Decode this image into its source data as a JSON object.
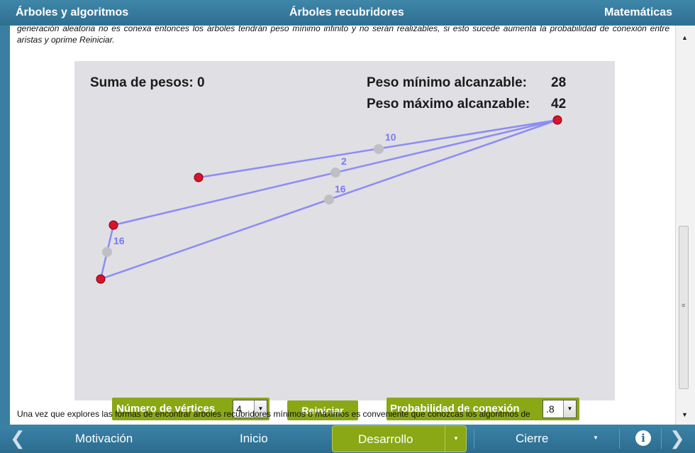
{
  "header": {
    "left_title": "Árboles y algoritmos",
    "center_title": "Árboles recubridores",
    "right_title": "Matemáticas"
  },
  "content": {
    "top_paragraph": "generación aleatoria no es conexa entonces los árboles tendrán peso mínimo infinito y no serán realizables, si esto sucede aumenta la probabilidad de conexión entre aristas y oprime Reiniciar.",
    "bottom_paragraph": "Una vez que explores las formas de encontrar árboles recubridores mínimos o máximos es conveniente que conozcas los algoritmos de"
  },
  "simulation": {
    "sum_label": "Suma de pesos: 0",
    "min_label": "Peso mínimo alcanzable:",
    "min_value": "28",
    "max_label": "Peso máximo alcanzable:",
    "max_value": "42",
    "edge_weights": [
      "10",
      "2",
      "16",
      "16"
    ],
    "colors": {
      "edge": "#8c8cf4",
      "vertex": "#d8142c",
      "midpoint": "#c0c0c4",
      "background": "#e0dfe3"
    }
  },
  "controls": {
    "vertices_label": "Número de vértices",
    "vertices_value": "4",
    "reset_label": "Reiniciar",
    "probability_label": "Probabilidad de conexión",
    "probability_value": ".8"
  },
  "nav": {
    "prev_icon": "chevron-left-icon",
    "motivacion": "Motivación",
    "inicio": "Inicio",
    "desarrollo": "Desarrollo",
    "cierre": "Cierre",
    "info_icon": "info-icon",
    "next_icon": "chevron-right-icon",
    "accent_color": "#8aa716"
  }
}
